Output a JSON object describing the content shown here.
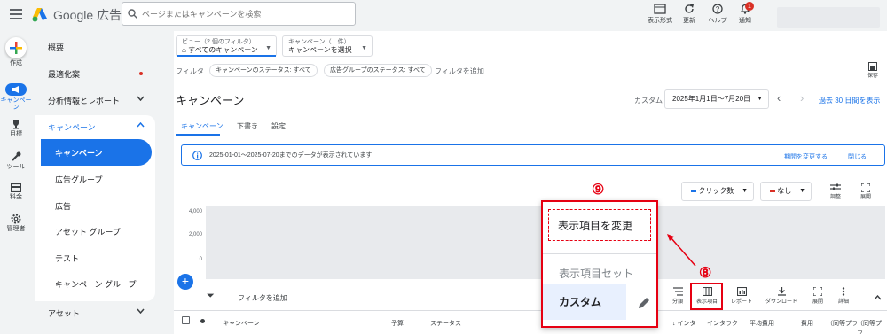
{
  "header": {
    "logo_text": "Google 広告",
    "search_placeholder": "ページまたはキャンペーンを検索",
    "tools": [
      {
        "label": "表示形式",
        "icon": "appearance-icon"
      },
      {
        "label": "更新",
        "icon": "refresh-icon"
      },
      {
        "label": "ヘルプ",
        "icon": "help-icon"
      },
      {
        "label": "通知",
        "icon": "bell-icon",
        "badge": "1"
      }
    ]
  },
  "rail": [
    {
      "label": "作成",
      "icon": "plus-icon"
    },
    {
      "label": "キャンペーン",
      "icon": "campaign-icon"
    },
    {
      "label": "目標",
      "icon": "trophy-icon"
    },
    {
      "label": "ツール",
      "icon": "wrench-icon"
    },
    {
      "label": "料金",
      "icon": "billing-icon"
    },
    {
      "label": "管理者",
      "icon": "gear-icon"
    }
  ],
  "nav": {
    "overview": "概要",
    "recommendations": "最適化案",
    "insights": "分析情報とレポート",
    "campaigns_section": "キャンペーン",
    "items": [
      "キャンペーン",
      "広告グループ",
      "広告",
      "アセット グループ",
      "テスト",
      "キャンペーン グループ"
    ],
    "assets": "アセット"
  },
  "filters": {
    "view_label": "ビュー（2 個のフィルタ）",
    "view_value": "すべてのキャンペーン",
    "campaign_label": "キャンペーン（　件）",
    "campaign_value": "キャンペーンを選択",
    "filter_label": "フィルタ",
    "chips": [
      "キャンペーンのステータス: すべて",
      "広告グループのステータス: すべて"
    ],
    "add_filter": "フィルタを追加",
    "save": "保存"
  },
  "page": {
    "title": "キャンペーン",
    "custom": "カスタム",
    "date_range": "2025年1月1日〜7月20日",
    "last30": "過去 30 日間を表示",
    "tabs": [
      "キャンペーン",
      "下書き",
      "設定"
    ]
  },
  "banner": {
    "text": "2025-01-01～2025-07-20までのデータが表示されています",
    "change_period": "期間を変更する",
    "close": "閉じる"
  },
  "chart": {
    "metric1": "クリック数",
    "metric2": "なし",
    "adjust": "調整",
    "expand": "展開",
    "yticks": [
      "4,000",
      "2,000",
      "0"
    ]
  },
  "toolbar": {
    "filter_add": "フィルタを追加",
    "items": [
      "分類",
      "表示項目",
      "レポート",
      "ダウンロード",
      "展開",
      "詳細"
    ]
  },
  "table": {
    "headers": [
      "キャンペーン",
      "予算",
      "ステータス",
      "↓ インタ",
      "インタラク",
      "平均費用",
      "費用",
      "（同等プラ",
      "（同等プラ"
    ]
  },
  "popup": {
    "change_columns": "表示項目を変更",
    "column_sets": "表示項目セット",
    "custom": "カスタム"
  },
  "annotations": {
    "step8": "⑧",
    "step9": "⑨"
  }
}
